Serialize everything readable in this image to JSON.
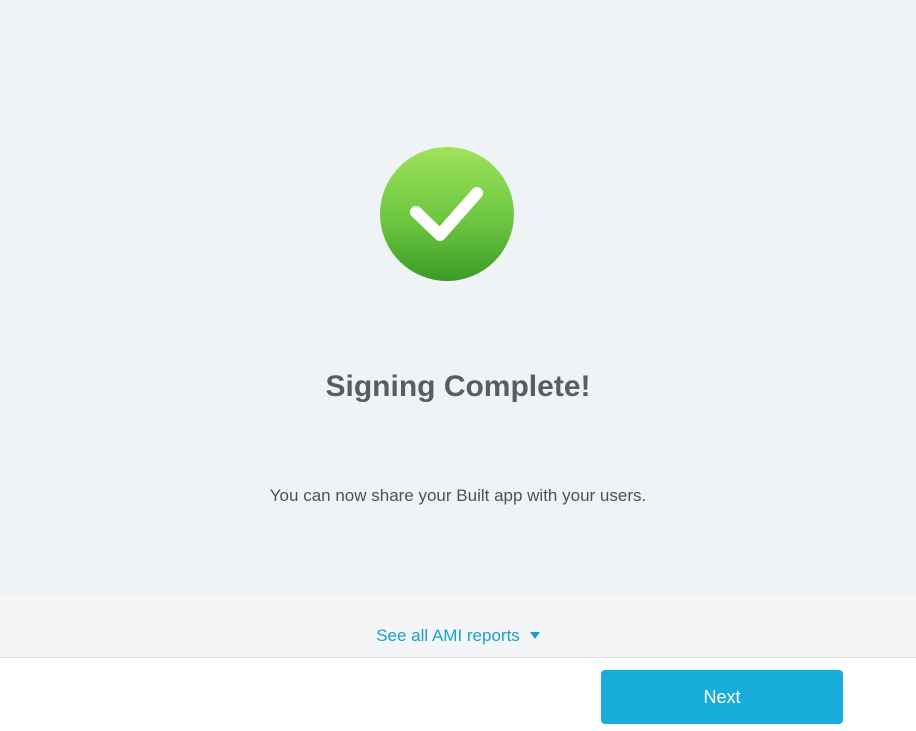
{
  "status": {
    "icon": "check-circle-icon",
    "title": "Signing Complete!",
    "message": "You can now share your Built app with your users."
  },
  "reports": {
    "link_label": "See all AMI reports",
    "caret_icon": "caret-down-icon"
  },
  "footer": {
    "next_label": "Next"
  },
  "colors": {
    "accent": "#17acd9",
    "link": "#1a9fd0",
    "success_top": "#9ee35a",
    "success_bottom": "#3c9a26",
    "panel_background": "#f0f3f6"
  }
}
